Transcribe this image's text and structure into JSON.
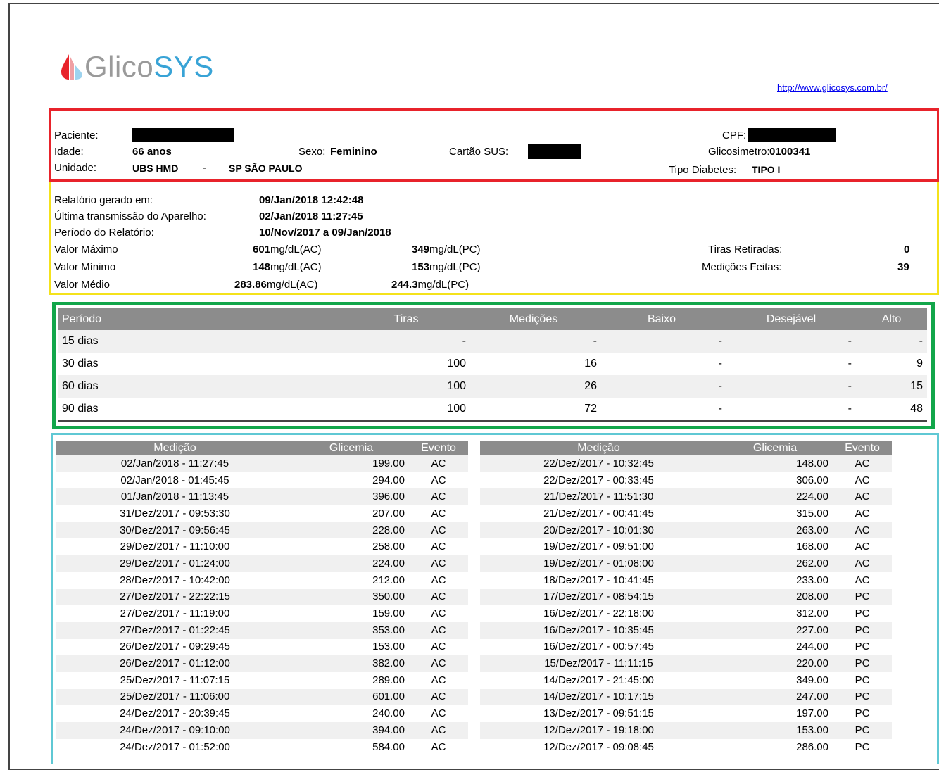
{
  "brand": {
    "name_part1": "Glico",
    "name_part2": "SYS",
    "url": "http://www.glicosys.com.br/"
  },
  "patient": {
    "paciente_label": "Paciente:",
    "idade_label": "Idade:",
    "idade_value": "66 anos",
    "sexo_label": "Sexo:",
    "sexo_value": "Feminino",
    "cartao_label": "Cartão SUS:",
    "unidade_label": "Unidade:",
    "unidade_value": "UBS HMD",
    "unidade_sep": "-",
    "unidade_city": "SP SÃO PAULO",
    "cpf_label": "CPF:",
    "glicosimetro_label": "Glicosimetro:",
    "glicosimetro_value": "0100341",
    "tipo_label": "Tipo Diabetes:",
    "tipo_value": "TIPO I"
  },
  "report": {
    "gerado_label": "Relatório gerado em:",
    "gerado_value": "09/Jan/2018  12:42:48",
    "ultima_label": "Última transmissão do Aparelho:",
    "ultima_value": "02/Jan/2018  11:27:45",
    "periodo_label": "Período do Relatório:",
    "periodo_value": "10/Nov/2017 a 09/Jan/2018",
    "max_label": "Valor Máximo",
    "max_ac": "601",
    "max_pc": "349",
    "min_label": "Valor Mínimo",
    "min_ac": "148",
    "min_pc": "153",
    "med_label": "Valor Médio",
    "med_ac": "283.86",
    "med_pc": "244.3",
    "unit_ac": "mg/dL(AC)",
    "unit_pc": "mg/dL(PC)",
    "tiras_label": "Tiras Retiradas:",
    "tiras_value": "0",
    "medicoes_label": "Medições Feitas:",
    "medicoes_value": "39"
  },
  "summary": {
    "headers": [
      "Período",
      "Tiras",
      "Medições",
      "Baixo",
      "Desejável",
      "Alto"
    ],
    "rows": [
      [
        "15 dias",
        "-",
        "-",
        "-",
        "-",
        "-"
      ],
      [
        "30 dias",
        "100",
        "16",
        "-",
        "-",
        "9"
      ],
      [
        "60 dias",
        "100",
        "26",
        "-",
        "-",
        "15"
      ],
      [
        "90 dias",
        "100",
        "72",
        "-",
        "-",
        "48"
      ]
    ]
  },
  "measurements": {
    "headers": [
      "Medição",
      "Glicemia",
      "Evento"
    ],
    "left": [
      [
        "02/Jan/2018 - 11:27:45",
        "199.00",
        "AC"
      ],
      [
        "02/Jan/2018 - 01:45:45",
        "294.00",
        "AC"
      ],
      [
        "01/Jan/2018 - 11:13:45",
        "396.00",
        "AC"
      ],
      [
        "31/Dez/2017 - 09:53:30",
        "207.00",
        "AC"
      ],
      [
        "30/Dez/2017 - 09:56:45",
        "228.00",
        "AC"
      ],
      [
        "29/Dez/2017 - 11:10:00",
        "258.00",
        "AC"
      ],
      [
        "29/Dez/2017 - 01:24:00",
        "224.00",
        "AC"
      ],
      [
        "28/Dez/2017 - 10:42:00",
        "212.00",
        "AC"
      ],
      [
        "27/Dez/2017 - 22:22:15",
        "350.00",
        "AC"
      ],
      [
        "27/Dez/2017 - 11:19:00",
        "159.00",
        "AC"
      ],
      [
        "27/Dez/2017 - 01:22:45",
        "353.00",
        "AC"
      ],
      [
        "26/Dez/2017 - 09:29:45",
        "153.00",
        "AC"
      ],
      [
        "26/Dez/2017 - 01:12:00",
        "382.00",
        "AC"
      ],
      [
        "25/Dez/2017 - 11:07:15",
        "289.00",
        "AC"
      ],
      [
        "25/Dez/2017 - 11:06:00",
        "601.00",
        "AC"
      ],
      [
        "24/Dez/2017 - 20:39:45",
        "240.00",
        "AC"
      ],
      [
        "24/Dez/2017 - 09:10:00",
        "394.00",
        "AC"
      ],
      [
        "24/Dez/2017 - 01:52:00",
        "584.00",
        "AC"
      ]
    ],
    "right": [
      [
        "22/Dez/2017 - 10:32:45",
        "148.00",
        "AC"
      ],
      [
        "22/Dez/2017 - 00:33:45",
        "306.00",
        "AC"
      ],
      [
        "21/Dez/2017 - 11:51:30",
        "224.00",
        "AC"
      ],
      [
        "21/Dez/2017 - 00:41:45",
        "315.00",
        "AC"
      ],
      [
        "20/Dez/2017 - 10:01:30",
        "263.00",
        "AC"
      ],
      [
        "19/Dez/2017 - 09:51:00",
        "168.00",
        "AC"
      ],
      [
        "19/Dez/2017 - 01:08:00",
        "262.00",
        "AC"
      ],
      [
        "18/Dez/2017 - 10:41:45",
        "233.00",
        "AC"
      ],
      [
        "17/Dez/2017 - 08:54:15",
        "208.00",
        "PC"
      ],
      [
        "16/Dez/2017 - 22:18:00",
        "312.00",
        "PC"
      ],
      [
        "16/Dez/2017 - 10:35:45",
        "227.00",
        "PC"
      ],
      [
        "16/Dez/2017 - 00:57:45",
        "244.00",
        "PC"
      ],
      [
        "15/Dez/2017 - 11:11:15",
        "220.00",
        "PC"
      ],
      [
        "14/Dez/2017 - 21:45:00",
        "349.00",
        "PC"
      ],
      [
        "14/Dez/2017 - 10:17:15",
        "247.00",
        "PC"
      ],
      [
        "13/Dez/2017 - 09:51:15",
        "197.00",
        "PC"
      ],
      [
        "12/Dez/2017 - 19:18:00",
        "153.00",
        "PC"
      ],
      [
        "12/Dez/2017 - 09:08:45",
        "286.00",
        "PC"
      ]
    ]
  },
  "colors": {
    "red_box": "#e8232b",
    "yellow_box": "#f4e21b",
    "green_box": "#12a64a",
    "cyan_box": "#5fc8d4",
    "header_gray": "#8c8c8c",
    "brand_blue": "#38a3d6"
  }
}
